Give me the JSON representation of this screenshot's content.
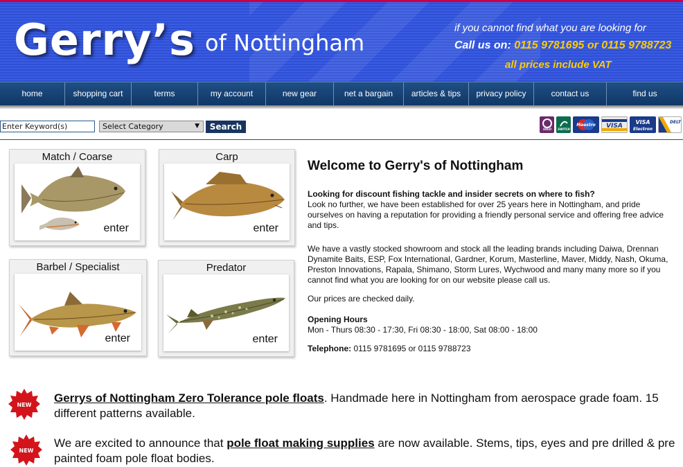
{
  "header": {
    "logo_main": "Gerry’s",
    "logo_sub": "of Nottingham",
    "line1": "if you cannot find what you are looking for",
    "call_label": "Call us on:",
    "call_numbers": "0115 9781695 or 0115 9788723",
    "line3": "all prices include VAT"
  },
  "nav": {
    "items": [
      {
        "label": "home"
      },
      {
        "label": "shopping cart"
      },
      {
        "label": "terms"
      },
      {
        "label": "my account"
      },
      {
        "label": "new gear"
      },
      {
        "label": "net a bargain"
      },
      {
        "label": "articles & tips"
      },
      {
        "label": "privacy policy"
      },
      {
        "label": "contact us"
      },
      {
        "label": "find us"
      }
    ]
  },
  "search": {
    "keyword_value": "Enter Keyword(s)",
    "category_selected": "Select Category",
    "button_label": "Search"
  },
  "payment_cards": [
    "Solo",
    "Switch",
    "Maestro",
    "VISA",
    "VISA Electron",
    "Delta"
  ],
  "categories": [
    {
      "title": "Match / Coarse",
      "enter": "enter"
    },
    {
      "title": "Carp",
      "enter": "enter"
    },
    {
      "title": "Barbel / Specialist",
      "enter": "enter"
    },
    {
      "title": "Predator",
      "enter": "enter"
    }
  ],
  "main": {
    "welcome": "Welcome to Gerry's of Nottingham",
    "intro_bold": "Looking for discount fishing tackle and insider secrets on where to fish?",
    "intro_text": "Look no further, we have been established for over 25 years here in Nottingham, and pride ourselves on having a reputation for providing a friendly personal service and offering free advice and tips.",
    "stock_text": "We have a vastly stocked showroom and stock all the leading brands including Daiwa, Drennan Dynamite Baits, ESP, Fox International, Gardner, Korum, Masterline, Maver, Middy, Nash, Okuma, Preston Innovations, Rapala, Shimano, Storm Lures, Wychwood and many many more so if you cannot find what you are looking for on our website please call us.",
    "prices_text": "Our prices are checked daily.",
    "hours_label": "Opening Hours",
    "hours_text": "Mon - Thurs 08:30 - 17:30, Fri 08:30 - 18:00, Sat 08:00 - 18:00",
    "telephone_label": "Telephone:",
    "telephone_text": " 0115 9781695 or 0115 9788723"
  },
  "news": [
    {
      "badge": "NEW",
      "link": "Gerrys of Nottingham Zero Tolerance pole floats",
      "text": ". Handmade here in Nottingham from aerospace grade foam. 15 different patterns available."
    },
    {
      "badge": "NEW",
      "prefix": "We are excited to announce that ",
      "link": "pole float making supplies",
      "text": " are now available. Stems, tips, eyes and pre drilled & pre painted foam pole float bodies."
    }
  ],
  "colors": {
    "header_blue": "#2e4fd6",
    "accent_yellow": "#ffcc00",
    "nav_blue": "#1f4f85",
    "badge_red": "#d4141b"
  }
}
